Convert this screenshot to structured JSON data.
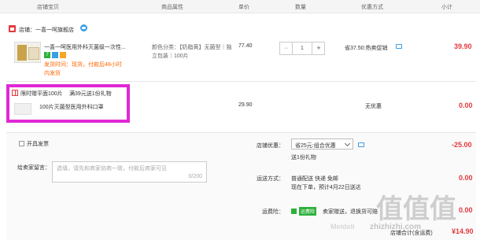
{
  "table_header": {
    "store_product": "店铺宝贝",
    "attribute": "商品属性",
    "unit_price": "单价",
    "quantity": "数量",
    "discount": "优惠方式",
    "subtotal": "小计"
  },
  "store": {
    "label": "店铺：",
    "name": "一喜一呵旗舰店"
  },
  "item": {
    "title": "一喜一呵医用外科灭菌级一次性...",
    "badge_7": "7",
    "attr_line1": "颜色分类：【奶脂黄】无菌型｜独",
    "attr_line2": "立包装｜100片",
    "shipping_line1": "发货时间：现货，付款后48小时",
    "shipping_line2": "内发货",
    "price": "77.40",
    "qty": "1",
    "minus": "−",
    "plus": "+",
    "discount": "省37.50:热卖促销",
    "subtotal": "39.90"
  },
  "gift": {
    "header": "限时赠平面100片",
    "condition": "满39元送1份礼物",
    "name": "100片灭菌型医用外科口罩",
    "price": "29.90",
    "discount": "无优惠",
    "subtotal": "0.00"
  },
  "bottom": {
    "invoice_label": "开具发票",
    "remark_label": "给卖家留言：",
    "remark_placeholder": "选填，请先和商家协商一致，付款后商家可见",
    "remark_counter": "0/200",
    "coupon_label": "店铺优惠：",
    "coupon_value": "省25元:组合优惠",
    "coupon_sub": "送1份礼物",
    "coupon_amount": "-25.00",
    "shipping_label": "运送方式：",
    "shipping_line1": "普通配送 快递 免邮",
    "shipping_line2": "现在下单，预计4月22日送达",
    "shipping_amount": "0.00",
    "insurance_label": "运费险：",
    "insurance_badge": "运费险",
    "insurance_text": "卖家赠送，退换货可赔",
    "total_label": "店铺合计(含运费)",
    "total_value": "¥14.90"
  },
  "watermark": {
    "big": "值值值",
    "small": "zhizhizhi.com",
    "side": "Meideli"
  },
  "colors": {
    "red": "#e4393c",
    "highlight": "#e028d5",
    "orange": "#ff6600",
    "green": "#2eb13c"
  }
}
